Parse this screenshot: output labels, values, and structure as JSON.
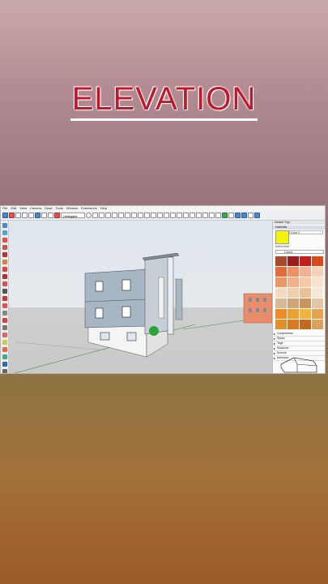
{
  "title": "ELEVATION",
  "menu": [
    "File",
    "Edit",
    "View",
    "Camera",
    "Draw",
    "Tools",
    "Window",
    "Extensions",
    "Help"
  ],
  "toolbar": {
    "layer_value": "Untagged"
  },
  "tray": {
    "header": "Default Tray",
    "panel": "Materials",
    "material_name": "Color 0",
    "tabs": [
      "Select",
      "Edit"
    ],
    "collection": "Colors",
    "swatches": [
      "#a84a2e",
      "#9b1e1e",
      "#c21f1f",
      "#d94a1a",
      "#e56c3a",
      "#ef8f62",
      "#f2b28f",
      "#f8d0b8",
      "#e89866",
      "#f1b08a",
      "#f6caa9",
      "#fbe0cc",
      "#f3d9c0",
      "#efcfa9",
      "#e8c294",
      "#f7e7d6",
      "#d9b896",
      "#cfa57a",
      "#c79660",
      "#e2c6a6",
      "#f08a28",
      "#f0a030",
      "#f2b33b",
      "#e8a24c",
      "#e0902a",
      "#d87a22",
      "#c56a1c",
      "#dba05a"
    ],
    "sections": [
      "Components",
      "Styles",
      "Tags",
      "Shadows",
      "Scenes",
      "Instructor"
    ]
  },
  "colors": {
    "accent_title": "#c0182a",
    "material": "#f7f209"
  }
}
